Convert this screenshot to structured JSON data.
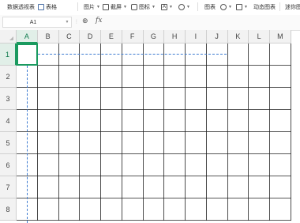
{
  "ribbon": {
    "pivot": "数据透视表",
    "table": "表格",
    "picture": "图片",
    "screenshot": "截屏",
    "icon": "图标",
    "chart": "图表",
    "dynamic_chart": "动态图表",
    "sparkline": "迷你图"
  },
  "formula_bar": {
    "cell_ref": "A1",
    "fx_label": "fx",
    "value": ""
  },
  "sheet": {
    "columns": [
      "A",
      "B",
      "C",
      "D",
      "E",
      "F",
      "G",
      "H",
      "I",
      "J",
      "K",
      "L",
      "M"
    ],
    "rows": [
      "1",
      "2",
      "3",
      "4",
      "5",
      "6",
      "7",
      "8"
    ],
    "selected_cell": "A1"
  },
  "colors": {
    "accent_green": "#1a9a5f",
    "page_break_blue": "#3d7bd0",
    "header_bg": "#f2f2f2"
  }
}
